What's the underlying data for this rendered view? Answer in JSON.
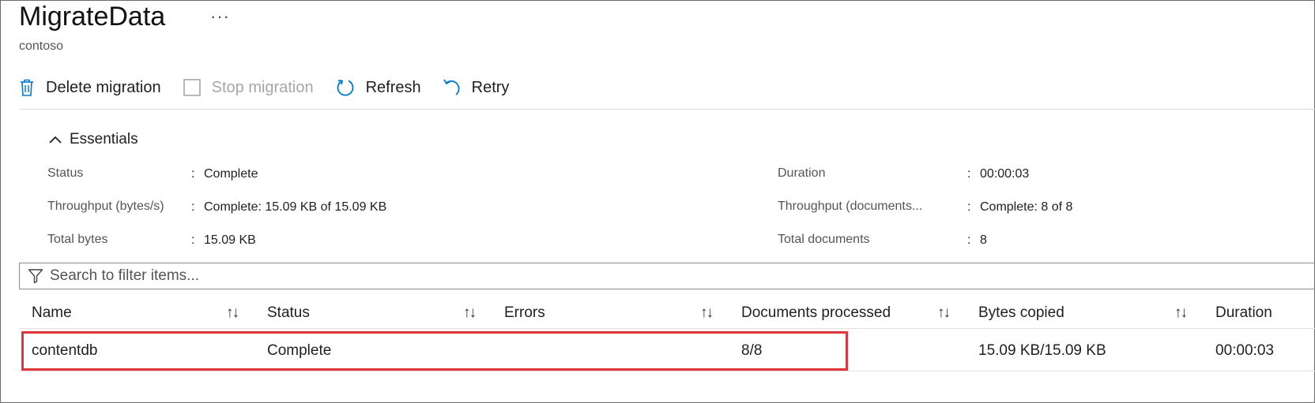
{
  "header": {
    "title": "MigrateData",
    "more": "···",
    "subtitle": "contoso"
  },
  "toolbar": {
    "delete_label": "Delete migration",
    "stop_label": "Stop migration",
    "refresh_label": "Refresh",
    "retry_label": "Retry"
  },
  "essentials": {
    "toggle_label": "Essentials",
    "left": [
      {
        "label": "Status",
        "value": "Complete"
      },
      {
        "label": "Throughput (bytes/s)",
        "value": "Complete: 15.09 KB of 15.09 KB"
      },
      {
        "label": "Total bytes",
        "value": "15.09 KB"
      }
    ],
    "right": [
      {
        "label": "Duration",
        "value": "00:00:03"
      },
      {
        "label": "Throughput (documents...",
        "value": "Complete: 8 of 8"
      },
      {
        "label": "Total documents",
        "value": "8"
      }
    ],
    "colon": ":"
  },
  "search": {
    "placeholder": "Search to filter items..."
  },
  "table": {
    "columns": [
      "Name",
      "Status",
      "Errors",
      "Documents processed",
      "Bytes copied",
      "Duration"
    ],
    "sort_glyph": "↑↓",
    "rows": [
      {
        "name": "contentdb",
        "status": "Complete",
        "errors": "",
        "documents_processed": "8/8",
        "bytes_copied": "15.09 KB/15.09 KB",
        "duration": "00:00:03"
      }
    ]
  },
  "colors": {
    "accent": "#0078d4",
    "highlight": "#e0363b"
  }
}
